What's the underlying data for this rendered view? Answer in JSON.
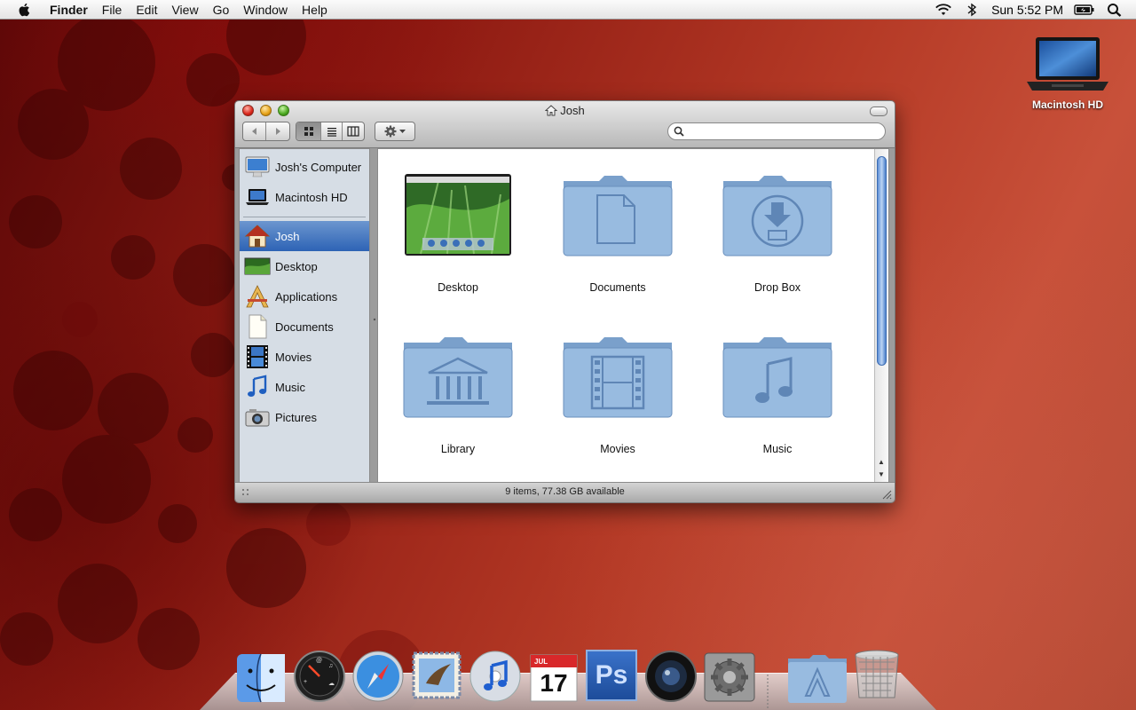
{
  "menubar": {
    "apple_icon": "apple-icon",
    "app_name": "Finder",
    "menus": [
      "File",
      "Edit",
      "View",
      "Go",
      "Window",
      "Help"
    ],
    "status_icons": [
      "wifi-icon",
      "bluetooth-icon"
    ],
    "clock": "Sun 5:52 PM",
    "battery_icon": "battery-icon",
    "spotlight_icon": "spotlight-icon"
  },
  "desktop": {
    "hd_label": "Macintosh HD"
  },
  "window": {
    "title": "Josh",
    "title_icon": "home-icon",
    "search": {
      "placeholder": "",
      "value": ""
    },
    "view_modes": [
      "icon-view",
      "list-view",
      "column-view"
    ],
    "active_view": "icon-view",
    "status": "9 items, 77.38 GB available"
  },
  "sidebar": {
    "devices": [
      {
        "label": "Josh's Computer",
        "icon": "computer-icon"
      },
      {
        "label": "Macintosh HD",
        "icon": "laptop-icon"
      }
    ],
    "places": [
      {
        "label": "Josh",
        "icon": "home-icon",
        "selected": true
      },
      {
        "label": "Desktop",
        "icon": "desktop-icon"
      },
      {
        "label": "Applications",
        "icon": "applications-icon"
      },
      {
        "label": "Documents",
        "icon": "documents-icon"
      },
      {
        "label": "Movies",
        "icon": "movies-icon"
      },
      {
        "label": "Music",
        "icon": "music-icon"
      },
      {
        "label": "Pictures",
        "icon": "pictures-icon"
      }
    ]
  },
  "items": [
    {
      "label": "Desktop",
      "icon": "desktop-folder-icon"
    },
    {
      "label": "Documents",
      "icon": "documents-folder-icon"
    },
    {
      "label": "Drop Box",
      "icon": "dropbox-folder-icon"
    },
    {
      "label": "Library",
      "icon": "library-folder-icon"
    },
    {
      "label": "Movies",
      "icon": "movies-folder-icon"
    },
    {
      "label": "Music",
      "icon": "music-folder-icon"
    }
  ],
  "dock": {
    "apps": [
      "finder-icon",
      "dashboard-icon",
      "safari-icon",
      "mail-icon",
      "itunes-icon",
      "ical-icon",
      "photoshop-icon",
      "aperture-icon",
      "system-preferences-icon",
      "applications-stack-icon",
      "trash-icon"
    ],
    "ical_month": "JUL",
    "ical_day": "17",
    "photoshop_label": "Ps"
  },
  "colors": {
    "selection": "#3b6fc0",
    "sidebar_bg": "#d6dde5",
    "folder_blue": "#8fb2d8"
  }
}
